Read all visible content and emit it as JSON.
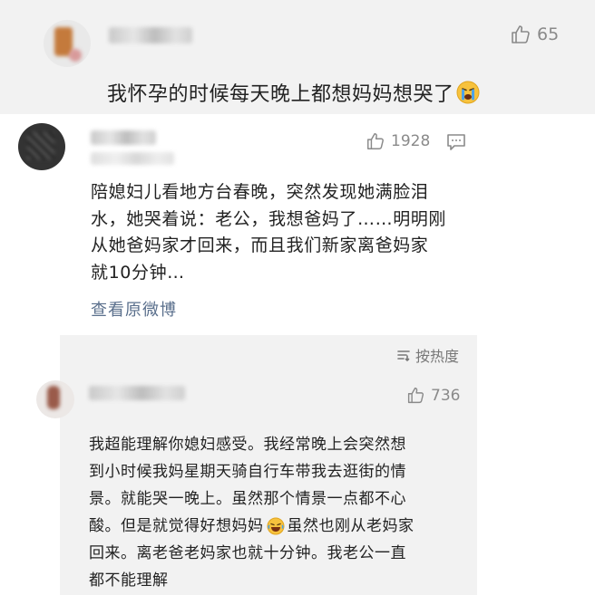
{
  "comment1": {
    "likes": "65",
    "text": "我怀孕的时候每天晚上都想妈妈想哭了",
    "emoji": "crying-face"
  },
  "post": {
    "likes": "1928",
    "text_lines": [
      "陪媳妇儿看地方台春晚，突然发现她满脸泪",
      "水，她哭着说：老公，我想爸妈了……明明刚",
      "从她爸妈家才回来，而且我们新家离爸妈家",
      "就10分钟…"
    ],
    "view_original": "查看原微博"
  },
  "sort": {
    "label": "按热度"
  },
  "comment2": {
    "likes": "736",
    "text_lines": [
      "我超能理解你媳妇感受。我经常晚上会突然想",
      "到小时候我妈星期天骑自行车带我去逛街的情",
      "景。就能哭一晚上。虽然那个情景一点都不心",
      "酸。但是就觉得好想妈妈",
      "虽然也刚从老妈家",
      "回来。离老爸老妈家也就十分钟。我老公一直",
      "都不能理解"
    ],
    "emoji": "laughing-face"
  },
  "colors": {
    "panel_gray": "#f2f2f2",
    "link_blue": "#5a6f8c",
    "meta_gray": "#888888"
  }
}
